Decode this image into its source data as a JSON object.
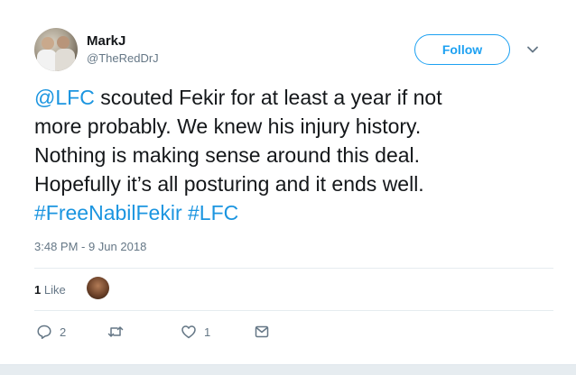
{
  "user": {
    "name": "MarkJ",
    "handle": "@TheRedDrJ"
  },
  "follow_label": "Follow",
  "tweet": {
    "lines": [
      [
        {
          "text": "@LFC",
          "link": true
        },
        {
          "text": " scouted Fekir for at least a year if not",
          "link": false
        }
      ],
      [
        {
          "text": "more probably. We knew his injury history.",
          "link": false
        }
      ],
      [
        {
          "text": "Nothing is making sense around this deal.",
          "link": false
        }
      ],
      [
        {
          "text": "Hopefully it’s all posturing and it ends well.",
          "link": false
        }
      ],
      [
        {
          "text": "#FreeNabilFekir",
          "link": true
        },
        {
          "text": " ",
          "link": false
        },
        {
          "text": "#LFC",
          "link": true
        }
      ]
    ]
  },
  "timestamp": "3:48 PM - 9 Jun 2018",
  "likes": {
    "count": "1",
    "label": "Like"
  },
  "actions": {
    "reply_count": "2",
    "retweet_count": "",
    "like_count": "1"
  },
  "colors": {
    "accent": "#1da1f2",
    "link": "#1b95e0",
    "secondary_text": "#657786"
  }
}
